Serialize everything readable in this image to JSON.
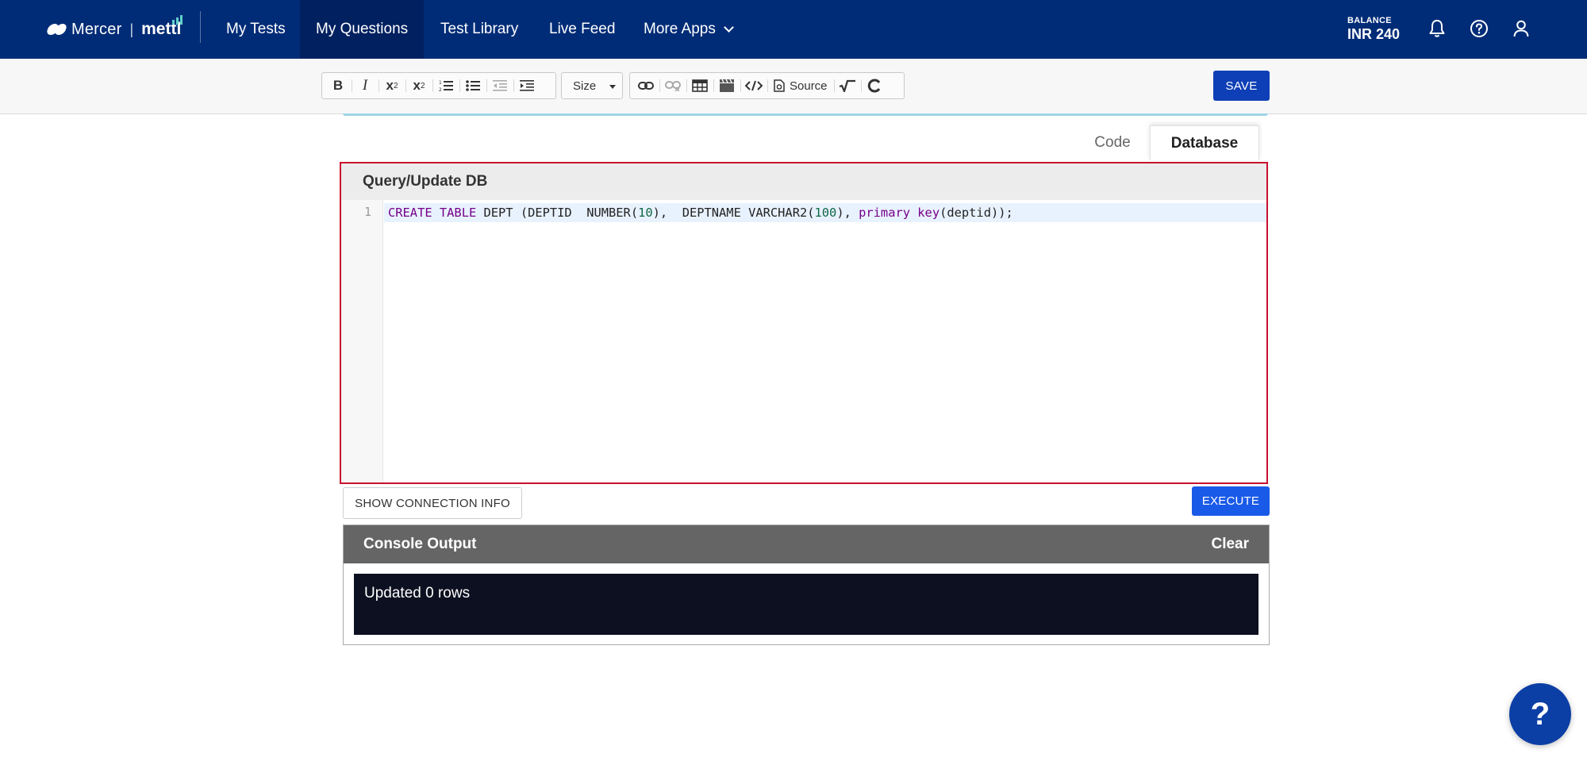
{
  "brand": {
    "name": "Mercer",
    "separator": "|",
    "product": "mettl"
  },
  "nav": {
    "items": [
      {
        "label": "My Tests"
      },
      {
        "label": "My Questions"
      },
      {
        "label": "Test Library"
      },
      {
        "label": "Live Feed"
      },
      {
        "label": "More Apps"
      }
    ],
    "active": "My Questions"
  },
  "balance": {
    "label": "BALANCE",
    "value": "INR 240"
  },
  "top_icons": [
    "bell-icon",
    "help-circle-icon",
    "user-icon"
  ],
  "toolbar": {
    "bold": "B",
    "italic": "I",
    "size_label": "Size",
    "source_label": "Source",
    "save_label": "SAVE"
  },
  "tabs": {
    "code": "Code",
    "database": "Database",
    "active": "Database"
  },
  "query_panel": {
    "title": "Query/Update DB",
    "line_number": "1",
    "code": "CREATE TABLE DEPT (DEPTID  NUMBER(10),  DEPTNAME VARCHAR2(100), primary key(deptid));"
  },
  "buttons": {
    "connection_info": "SHOW CONNECTION INFO",
    "execute": "EXECUTE"
  },
  "console": {
    "title": "Console Output",
    "clear": "Clear",
    "output": "Updated 0 rows"
  },
  "help_bubble": "?",
  "colors": {
    "nav_bg": "#002c77",
    "nav_active": "#002060",
    "highlight_border": "#c8102e",
    "execute": "#1a5ae8",
    "save": "#0f3fb6",
    "console_bg": "#0d1020"
  }
}
